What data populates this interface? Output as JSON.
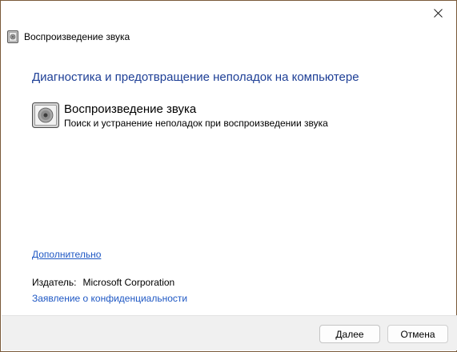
{
  "window": {
    "title": "Воспроизведение звука",
    "close_icon": "close-icon"
  },
  "main": {
    "heading": "Диагностика и предотвращение неполадок на компьютере",
    "item": {
      "icon": "speaker-icon",
      "title": "Воспроизведение звука",
      "description": "Поиск и устранение неполадок при воспроизведении звука"
    }
  },
  "links": {
    "advanced": "Дополнительно",
    "privacy": "Заявление о конфиденциальности"
  },
  "publisher": {
    "label": "Издатель:",
    "value": "Microsoft Corporation"
  },
  "buttons": {
    "next": "Далее",
    "cancel": "Отмена"
  },
  "colors": {
    "heading": "#1e3f96",
    "link": "#1f58c4",
    "footer_bg": "#f0f0f0",
    "window_border": "#7a5a3a"
  }
}
